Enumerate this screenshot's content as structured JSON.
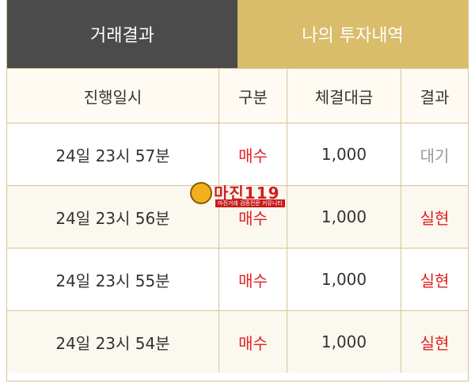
{
  "tabs": {
    "active": "거래결과",
    "inactive": "나의 투자내역"
  },
  "table": {
    "headers": [
      "진행일시",
      "구분",
      "체결대금",
      "결과"
    ],
    "rows": [
      {
        "time": "24일 23시 57분",
        "type": "매수",
        "amount": "1,000",
        "result": "대기",
        "result_color": "#9a9a9a"
      },
      {
        "time": "24일 23시 56분",
        "type": "매수",
        "amount": "1,000",
        "result": "실현",
        "result_color": "#e02020"
      },
      {
        "time": "24일 23시 55분",
        "type": "매수",
        "amount": "1,000",
        "result": "실현",
        "result_color": "#e02020"
      },
      {
        "time": "24일 23시 54분",
        "type": "매수",
        "amount": "1,000",
        "result": "실현",
        "result_color": "#e02020"
      }
    ]
  },
  "watermark": {
    "logo_text": "마진119",
    "tagline": "마진거래 검증전문 커뮤니티"
  },
  "colors": {
    "active_tab": "#4b4b4b",
    "inactive_tab": "#d9bd6b",
    "buy_red": "#e02020",
    "border": "#d6c49a"
  }
}
